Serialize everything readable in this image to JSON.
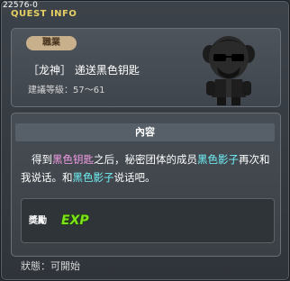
{
  "window": {
    "quest_id": "22576-0",
    "title": "QUEST INFO"
  },
  "header": {
    "job_label": "職業",
    "quest_name": "［龙神］ 递送黑色钥匙",
    "level_range": "建議等級：57～61"
  },
  "content": {
    "header": "內容",
    "desc_segments": {
      "s1": "得到",
      "s2": "黑色钥匙",
      "s3": "之后，秘密团体的成员",
      "s4": "黑色影子",
      "s5": "再次和我说话。和",
      "s6": "黑色影子",
      "s7": "说话吧。"
    }
  },
  "reward": {
    "label": "奬勵",
    "icon": "exp-icon",
    "icon_text": "EXP"
  },
  "status": {
    "text": "狀態：可開始"
  },
  "colors": {
    "title": "#e6cf63",
    "highlight_pink": "#f39de5",
    "highlight_cyan": "#6ff0f5",
    "exp_green": "#7ee21a"
  }
}
